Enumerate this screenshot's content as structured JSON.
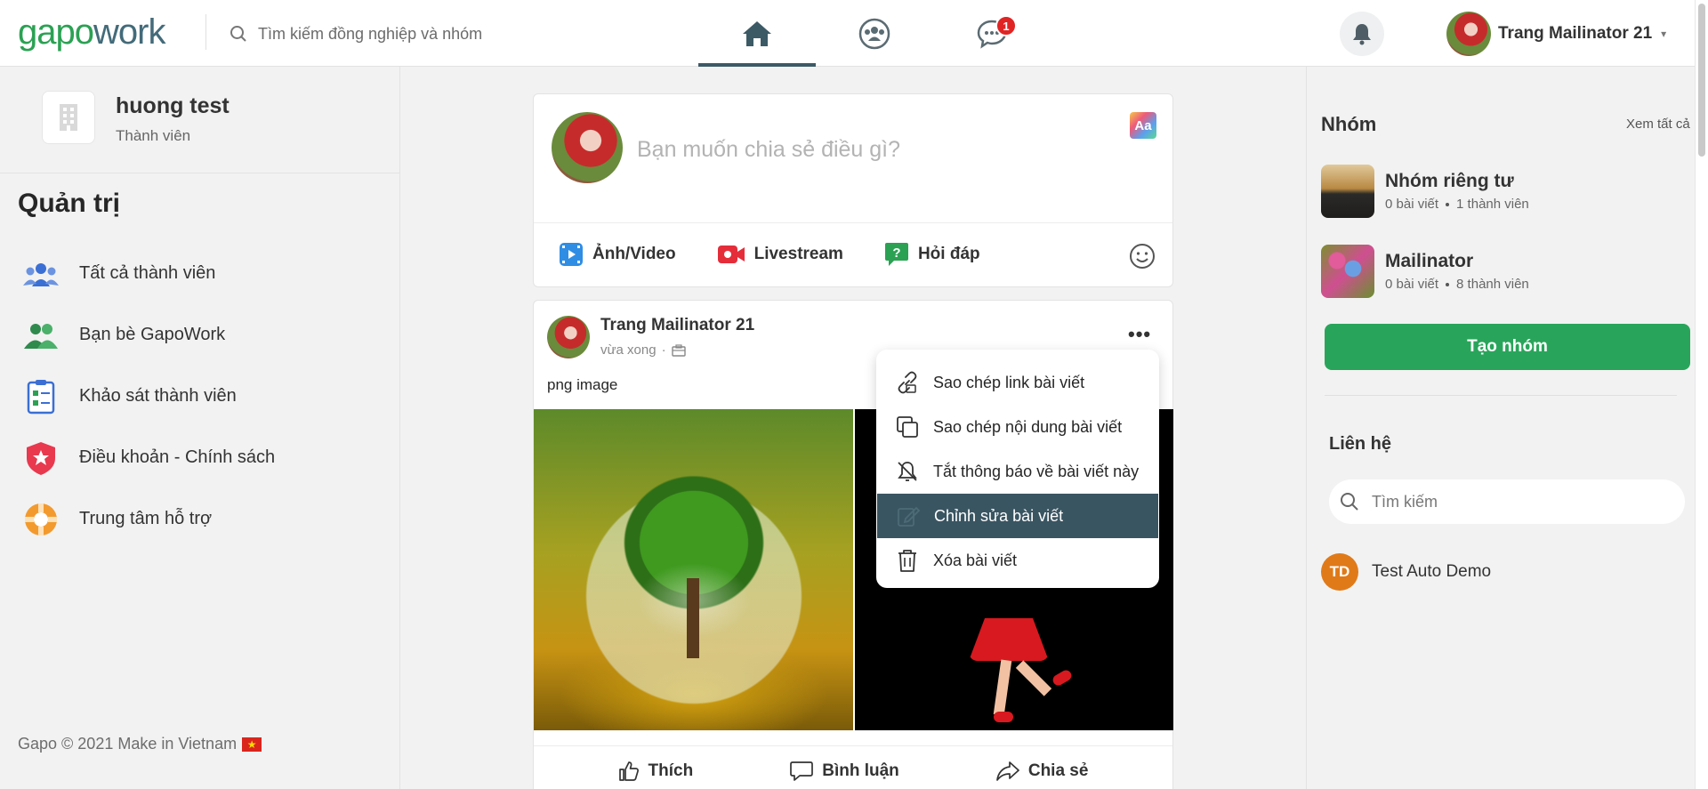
{
  "header": {
    "logo_part1": "gapo",
    "logo_part2": "work",
    "search_placeholder": "Tìm kiếm đồng nghiệp và nhóm",
    "chat_badge": "1",
    "user_name": "Trang Mailinator 21",
    "user_caret": "▾"
  },
  "sidebar": {
    "company_name": "huong test",
    "company_role": "Thành viên",
    "section_title": "Quản trị",
    "items": [
      {
        "label": "Tất cả thành viên",
        "icon": "members-icon"
      },
      {
        "label": "Bạn bè GapoWork",
        "icon": "friends-icon"
      },
      {
        "label": "Khảo sát thành viên",
        "icon": "survey-icon"
      },
      {
        "label": "Điều khoản - Chính sách",
        "icon": "policy-shield-icon"
      },
      {
        "label": "Trung tâm hỗ trợ",
        "icon": "support-lifebuoy-icon"
      }
    ],
    "footer": "Gapo © 2021 Make in Vietnam",
    "flag_star": "★"
  },
  "composer": {
    "placeholder": "Bạn muốn chia sẻ điều gì?",
    "font_button": "Aa",
    "actions": [
      {
        "label": "Ảnh/Video",
        "icon": "photo-video-icon"
      },
      {
        "label": "Livestream",
        "icon": "livestream-icon"
      },
      {
        "label": "Hỏi đáp",
        "icon": "qa-icon"
      }
    ]
  },
  "post": {
    "author": "Trang Mailinator 21",
    "time": "vừa xong",
    "more": "•••",
    "content": "png image",
    "reactions": [
      {
        "label": "Thích",
        "icon": "like-icon"
      },
      {
        "label": "Bình luận",
        "icon": "comment-icon"
      },
      {
        "label": "Chia sẻ",
        "icon": "share-icon"
      }
    ]
  },
  "dropdown": {
    "items": [
      {
        "label": "Sao chép link bài viết",
        "icon": "copy-link-icon",
        "active": false
      },
      {
        "label": "Sao chép nội dung bài viết",
        "icon": "copy-content-icon",
        "active": false
      },
      {
        "label": "Tắt thông báo về bài viết này",
        "icon": "bell-off-icon",
        "active": false
      },
      {
        "label": "Chỉnh sửa bài viết",
        "icon": "edit-icon",
        "active": true
      },
      {
        "label": "Xóa bài viết",
        "icon": "trash-icon",
        "active": false
      }
    ]
  },
  "right": {
    "groups_title": "Nhóm",
    "see_all": "Xem tất cả",
    "groups": [
      {
        "name": "Nhóm riêng tư",
        "posts": "0 bài viết",
        "members": "1 thành viên"
      },
      {
        "name": "Mailinator",
        "posts": "0 bài viết",
        "members": "8 thành viên"
      }
    ],
    "create_group": "Tạo nhóm",
    "contacts_title": "Liên hệ",
    "contacts_search_placeholder": "Tìm kiếm",
    "contacts": [
      {
        "initials": "TD",
        "name": "Test Auto Demo"
      }
    ]
  },
  "colors": {
    "brand_green": "#2ba153",
    "brand_slate": "#436b7a",
    "active_menu": "#3a5562",
    "create_button": "#29a55b",
    "badge_red": "#e02424"
  }
}
